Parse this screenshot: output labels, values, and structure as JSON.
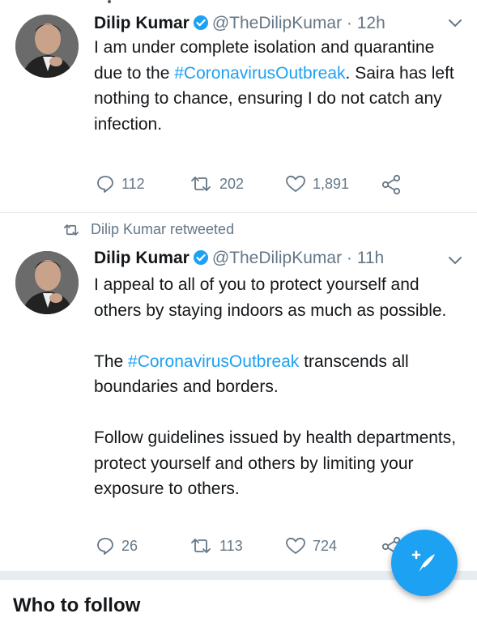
{
  "tweets": [
    {
      "author_name": "Dilip Kumar",
      "handle": "@TheDilipKumar",
      "time": "12h",
      "text_parts": [
        {
          "pre": "I am under complete isolation and quarantine due to the ",
          "hashtag": "#CoronavirusOutbreak",
          "post": ". Saira has left nothing to chance, ensuring I do not catch any infection."
        }
      ],
      "reply_count": "112",
      "retweet_count": "202",
      "like_count": "1,891"
    },
    {
      "retweet_label": "Dilip Kumar retweeted",
      "author_name": "Dilip Kumar",
      "handle": "@TheDilipKumar",
      "time": "11h",
      "para1": "I appeal to all of you to protect yourself and others by staying indoors as much as possible.",
      "para2_pre": "The ",
      "para2_hashtag": "#CoronavirusOutbreak",
      "para2_post": " transcends all boundaries and borders.",
      "para3": "Follow guidelines issued by health departments, protect yourself and others by limiting your exposure to others.",
      "reply_count": "26",
      "retweet_count": "113",
      "like_count": "724"
    }
  ],
  "separator": "·",
  "who_to_follow_title": "Who to follow",
  "icons": [
    "verified-badge-icon",
    "chevron-down-icon",
    "reply-icon",
    "retweet-icon",
    "like-icon",
    "share-icon",
    "compose-icon"
  ],
  "colors": {
    "accent": "#1da1f2",
    "muted": "#657786",
    "text": "#14171a"
  }
}
